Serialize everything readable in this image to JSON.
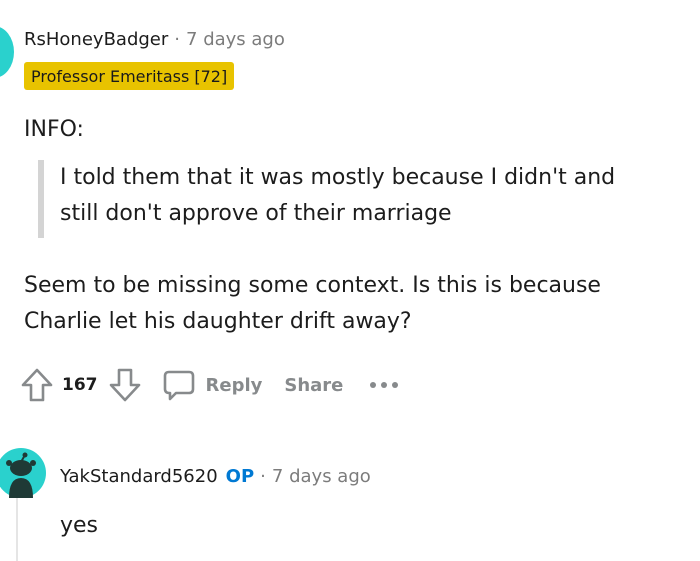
{
  "comment": {
    "username": "RsHoneyBadger",
    "separator": "·",
    "timestamp": "7 days ago",
    "flair": "Professor Emeritass [72]",
    "info_label": "INFO:",
    "quote_lines": [
      "I told them that it was mostly because I didn't and",
      "still don't approve of their marriage"
    ],
    "paragraph_lines": [
      "Seem to be missing some context. Is this is because",
      "Charlie let his daughter drift away?"
    ],
    "actions": {
      "upvote_icon": "upvote-arrow-icon",
      "vote_count": "167",
      "downvote_icon": "downvote-arrow-icon",
      "reply_icon": "speech-bubble-icon",
      "reply_label": "Reply",
      "share_label": "Share",
      "more_icon": "ellipsis-icon"
    },
    "colors": {
      "avatar": "#2ad1cd",
      "flair_bg": "#e8c300",
      "muted": "#878a8c",
      "op_badge": "#0079d3"
    }
  },
  "reply": {
    "username": "YakStandard5620",
    "op_label": "OP",
    "separator": "·",
    "timestamp": "7 days ago",
    "body": "yes",
    "avatar_icon": "snoo-avatar-icon"
  }
}
